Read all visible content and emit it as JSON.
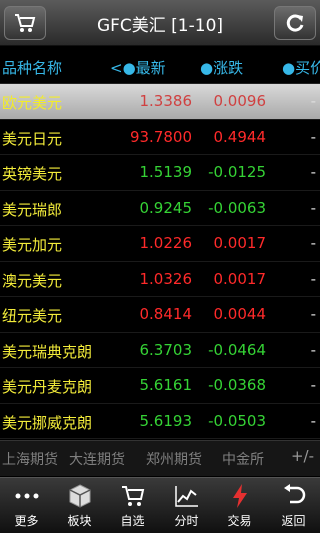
{
  "titlebar": {
    "title": "GFC美汇 [1-10]"
  },
  "header": {
    "name": "品种名称",
    "price": "<●最新",
    "change": "●涨跌",
    "bid": "●买价"
  },
  "rows": [
    {
      "name": "欧元美元",
      "price": "1.3386",
      "change": "0.0096",
      "bid": "-",
      "dir": "up",
      "selected": true
    },
    {
      "name": "美元日元",
      "price": "93.7800",
      "change": "0.4944",
      "bid": "-",
      "dir": "up"
    },
    {
      "name": "英镑美元",
      "price": "1.5139",
      "change": "-0.0125",
      "bid": "-",
      "dir": "down"
    },
    {
      "name": "美元瑞郎",
      "price": "0.9245",
      "change": "-0.0063",
      "bid": "-",
      "dir": "down"
    },
    {
      "name": "美元加元",
      "price": "1.0226",
      "change": "0.0017",
      "bid": "-",
      "dir": "up"
    },
    {
      "name": "澳元美元",
      "price": "1.0326",
      "change": "0.0017",
      "bid": "-",
      "dir": "up"
    },
    {
      "name": "纽元美元",
      "price": "0.8414",
      "change": "0.0044",
      "bid": "-",
      "dir": "up"
    },
    {
      "name": "美元瑞典克朗",
      "price": "6.3703",
      "change": "-0.0464",
      "bid": "-",
      "dir": "down"
    },
    {
      "name": "美元丹麦克朗",
      "price": "5.6161",
      "change": "-0.0368",
      "bid": "-",
      "dir": "down"
    },
    {
      "name": "美元挪威克朗",
      "price": "5.6193",
      "change": "-0.0503",
      "bid": "-",
      "dir": "down"
    }
  ],
  "exchanges": [
    "上海期货",
    "大连期货",
    "郑州期货",
    "中金所"
  ],
  "exchange_toggle": "+/-",
  "toolbar": [
    {
      "label": "更多",
      "icon": "more-icon"
    },
    {
      "label": "板块",
      "icon": "cube-icon"
    },
    {
      "label": "自选",
      "icon": "cart-icon"
    },
    {
      "label": "分时",
      "icon": "line-chart-icon"
    },
    {
      "label": "交易",
      "icon": "lightning-icon"
    },
    {
      "label": "返回",
      "icon": "back-icon"
    }
  ],
  "colors": {
    "up": "#ff2a2a",
    "down": "#35d335",
    "name": "#f3ec3a",
    "header": "#37b8e8"
  }
}
